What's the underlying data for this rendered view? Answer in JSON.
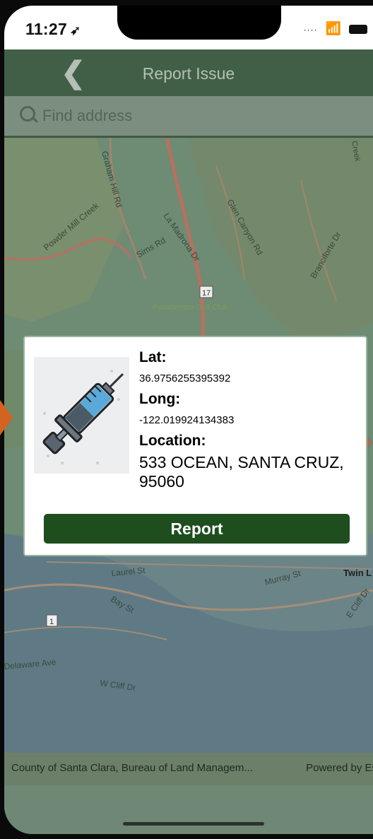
{
  "status_bar": {
    "time": "11:27",
    "location_arrow": "location-arrow-icon",
    "signal": "signal-icon",
    "wifi": "wifi-icon",
    "battery": "battery-icon"
  },
  "navbar": {
    "title": "Report Issue",
    "back_icon": "chevron-left-icon"
  },
  "search": {
    "placeholder": "Find address",
    "value": ""
  },
  "map": {
    "labels": [
      "Glen Canyon Rd",
      "Sims Rd",
      "La Madrona Dr",
      "Powder Mill Creek",
      "Graham Hill Rd",
      "Branciforte Dr",
      "Pasatiempo Golf Club",
      "17",
      "Laurel St",
      "Bay St",
      "Murray St",
      "Twin L",
      "E Cliff Dr",
      "Delaware Ave",
      "W Cliff Dr",
      "1",
      "Creek"
    ]
  },
  "popup": {
    "lat_label": "Lat:",
    "lat_value": "36.9756255395392",
    "long_label": "Long:",
    "long_value": "-122.019924134383",
    "location_label": "Location:",
    "location_value": "533 OCEAN, SANTA CRUZ, 95060",
    "button_label": "Report",
    "image": "syringe-icon"
  },
  "footer": {
    "attribution": "County of Santa Clara, Bureau of Land Managem...",
    "powered_by": "Powered by Es"
  },
  "colors": {
    "navbar": "#415f47",
    "button": "#1e4e1e",
    "arrow": "#d4631f"
  }
}
